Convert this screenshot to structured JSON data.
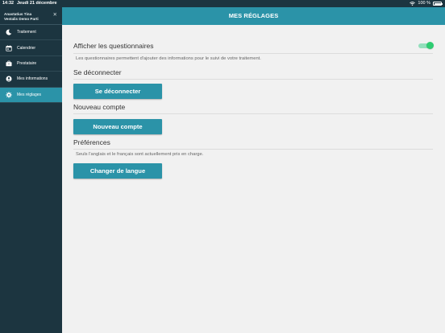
{
  "status_bar": {
    "time": "14:32",
    "date": "Jeudi 21 décembre",
    "battery": "100 %"
  },
  "sidebar": {
    "user_line1": "Anastatius Tina",
    "user_line2": "Vestalis Demo Parti",
    "close_symbol": "✕",
    "items": [
      {
        "label": "Traitement",
        "icon": "moon-icon"
      },
      {
        "label": "Calendrier",
        "icon": "calendar-icon"
      },
      {
        "label": "Prestataire",
        "icon": "briefcase-icon"
      },
      {
        "label": "Mes informations",
        "icon": "user-icon"
      },
      {
        "label": "Mes réglages",
        "icon": "gear-icon",
        "active": true
      }
    ]
  },
  "header": {
    "title": "MES RÉGLAGES"
  },
  "settings": {
    "questionnaires_label": "Afficher les questionnaires",
    "questionnaires_enabled": true,
    "questionnaires_note": "Les questionnaires permettent d'ajouter des informations pour le suivi de votre traitement.",
    "logout_heading": "Se déconnecter",
    "logout_button": "Se déconnecter",
    "new_account_heading": "Nouveau compte",
    "new_account_button": "Nouveau compte",
    "preferences_heading": "Préférences",
    "preferences_note": "Seuls l'anglais et le français sont actuellement pris en charge.",
    "language_button": "Changer de langue"
  },
  "colors": {
    "sidebar_bg": "#1c3540",
    "accent": "#2b93a8",
    "toggle_on": "#2ecc71",
    "content_bg": "#f1f1f1"
  }
}
